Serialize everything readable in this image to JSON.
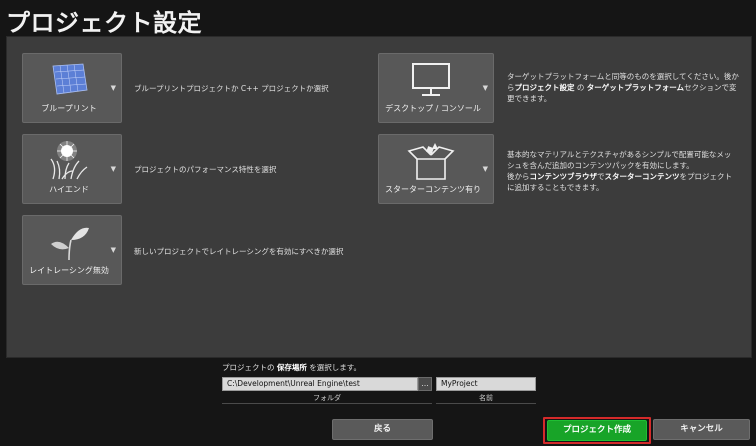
{
  "page_title": "プロジェクト設定",
  "cards": [
    {
      "label": "ブループリント",
      "icon": "blueprint-icon",
      "desc_parts": [
        "ブループリントプロジェクトか C++ プロジェクトか選択"
      ]
    },
    {
      "label": "ハイエンド",
      "icon": "sparkle-grass-icon",
      "desc_parts": [
        "プロジェクトのパフォーマンス特性を選択"
      ]
    },
    {
      "label": "レイトレーシング無効",
      "icon": "sprout-icon",
      "desc_parts": [
        "新しいプロジェクトでレイトレーシングを有効にすべきか選択"
      ]
    },
    {
      "label": "デスクトップ / コンソール",
      "icon": "monitor-icon",
      "desc_line1": "ターゲットプラットフォームと同等のものを選択してください。後か",
      "desc_line2_pre": "ら",
      "desc_bold1": "プロジェクト設定",
      "desc_mid": " の ",
      "desc_bold2": "ターゲットプラットフォーム",
      "desc_line2_post": "セクションで変",
      "desc_line3": "更できます。"
    },
    {
      "label": "スターターコンテンツ有り",
      "icon": "open-box-icon",
      "desc_line1": "基本的なマテリアルとテクスチャがあるシンプルで配置可能なメッ",
      "desc_line2": "シュを含んだ追加のコンテンツパックを有効にします。",
      "desc_line3_pre": "後から",
      "desc_bold1": "コンテンツブラウザ",
      "desc_mid": "で",
      "desc_bold2": "スターターコンテンツ",
      "desc_line3_post": "をプロジェクト",
      "desc_line4": "に追加することもできます。"
    }
  ],
  "location": {
    "caption_pre": "プロジェクトの ",
    "caption_bold": "保存場所",
    "caption_post": " を選択します。",
    "folder_value": "C:\\Development\\Unreal Engine\\test",
    "browse_label": "...",
    "name_value": "MyProject",
    "folder_label": "フォルダ",
    "name_label": "名前"
  },
  "buttons": {
    "back": "戻る",
    "create": "プロジェクト作成",
    "cancel": "キャンセル"
  },
  "colors": {
    "create_button": "#18a428",
    "highlight_border": "#d42a2a",
    "panel": "#3c3c3c",
    "card": "#585858"
  }
}
